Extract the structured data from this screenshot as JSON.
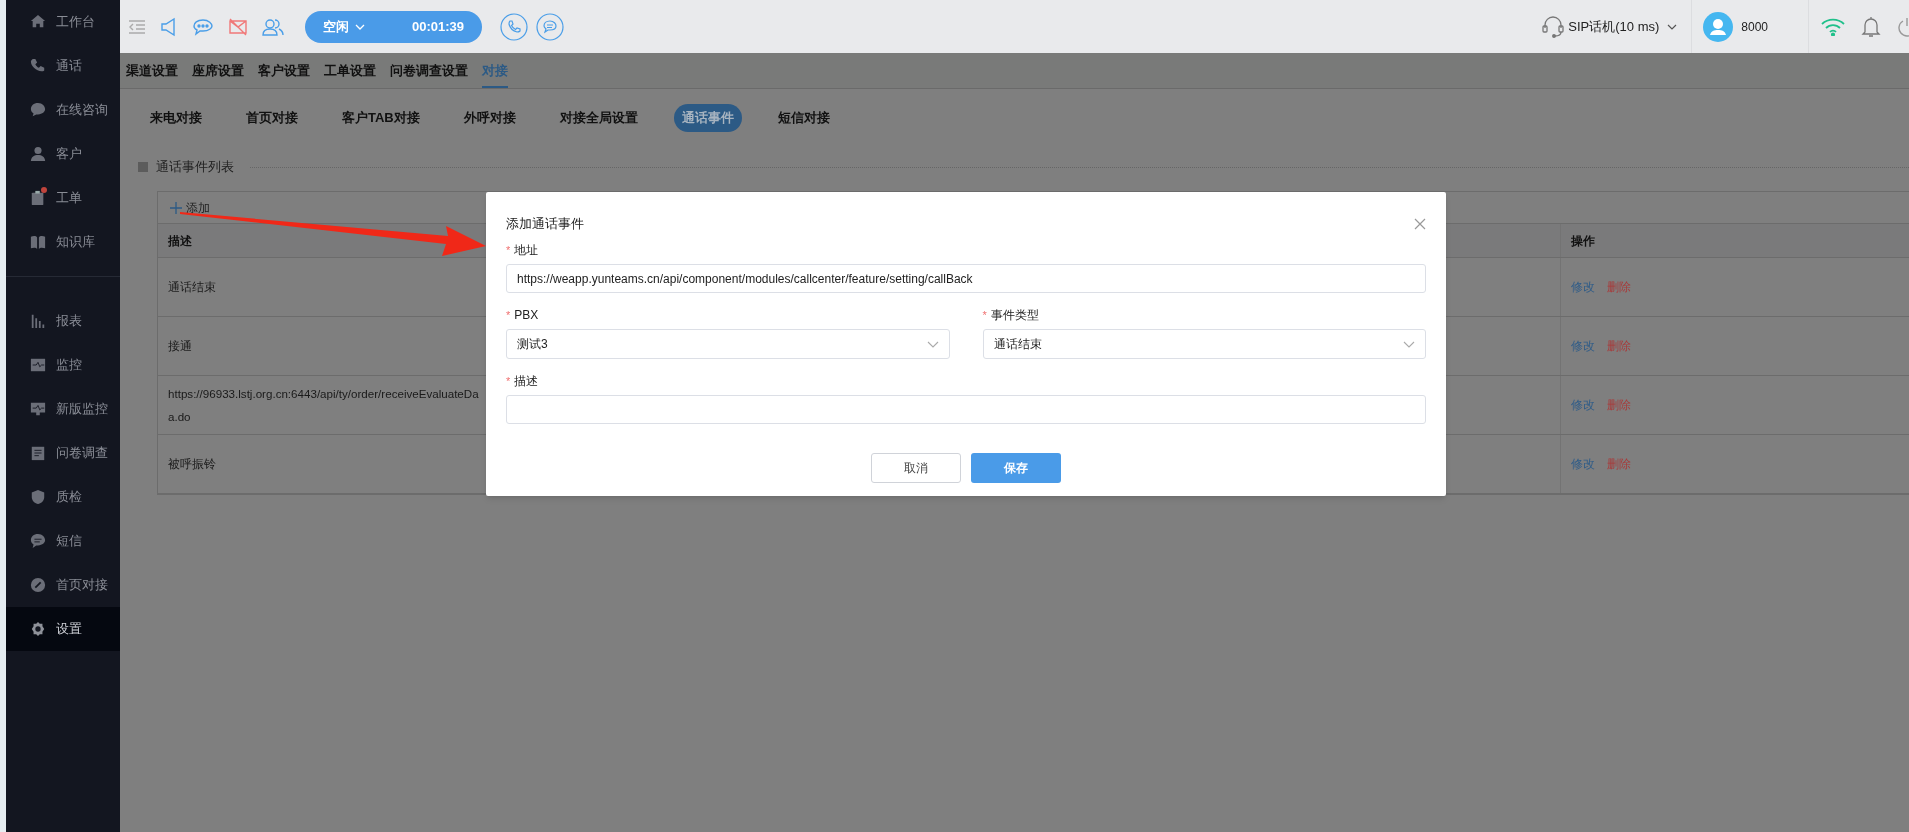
{
  "sidebar": {
    "groups": [
      {
        "items": [
          {
            "label": "工作台",
            "selected": false,
            "notification": false
          },
          {
            "label": "通话",
            "selected": false,
            "notification": false
          },
          {
            "label": "在线咨询",
            "selected": false,
            "notification": false
          },
          {
            "label": "客户",
            "selected": false,
            "notification": false
          },
          {
            "label": "工单",
            "selected": false,
            "notification": true
          },
          {
            "label": "知识库",
            "selected": false,
            "notification": false
          }
        ]
      },
      {
        "items": [
          {
            "label": "报表",
            "selected": false,
            "notification": false
          },
          {
            "label": "监控",
            "selected": false,
            "notification": false
          },
          {
            "label": "新版监控",
            "selected": false,
            "notification": false
          },
          {
            "label": "问卷调查",
            "selected": false,
            "notification": false
          },
          {
            "label": "质检",
            "selected": false,
            "notification": false
          },
          {
            "label": "短信",
            "selected": false,
            "notification": false
          },
          {
            "label": "首页对接",
            "selected": false,
            "notification": false
          },
          {
            "label": "设置",
            "selected": true,
            "notification": false
          }
        ]
      }
    ]
  },
  "top_bar": {
    "status": "空闲",
    "timer": "00:01:39",
    "phone": "SIP话机(10 ms)",
    "agent": "8000"
  },
  "tabs": [
    {
      "label": "渠道设置",
      "selected": false
    },
    {
      "label": "座席设置",
      "selected": false
    },
    {
      "label": "客户设置",
      "selected": false
    },
    {
      "label": "工单设置",
      "selected": false
    },
    {
      "label": "问卷调查设置",
      "selected": false
    },
    {
      "label": "对接",
      "selected": true
    }
  ],
  "sub_tabs": [
    {
      "label": "来电对接",
      "selected": false
    },
    {
      "label": "首页对接",
      "selected": false
    },
    {
      "label": "客户TAB对接",
      "selected": false
    },
    {
      "label": "外呼对接",
      "selected": false
    },
    {
      "label": "对接全局设置",
      "selected": false
    },
    {
      "label": "通话事件",
      "selected": true
    },
    {
      "label": "短信对接",
      "selected": false
    }
  ],
  "section_title": "通话事件列表",
  "add_button": "添加",
  "table": {
    "columns": [
      "描述",
      "操作"
    ],
    "rows": [
      {
        "description": [
          "通话结束"
        ],
        "actions": [
          "修改",
          "删除"
        ]
      },
      {
        "description": [
          "接通"
        ],
        "actions": [
          "修改",
          "删除"
        ]
      },
      {
        "description": [
          "https://96933.lstj.org.cn:6443/api/ty/order/receiveEvaluateDa",
          "a.do"
        ],
        "actions": [
          "修改",
          "删除"
        ]
      },
      {
        "description": [
          "被呼振铃"
        ],
        "actions": [
          "修改",
          "删除"
        ]
      }
    ]
  },
  "dialog": {
    "title": "添加通话事件",
    "fields": [
      {
        "mark": "*",
        "label": "地址",
        "kind": "input",
        "value": "https://weapp.yunteams.cn/api/component/modules/callcenter/feature/setting/callBack"
      },
      {
        "mark": "*",
        "label": "PBX",
        "kind": "select",
        "value": "测试3"
      },
      {
        "mark": "*",
        "label": "事件类型",
        "kind": "select",
        "value": "通话结束"
      },
      {
        "mark": "*",
        "label": "描述",
        "kind": "input"
      }
    ],
    "buttons": [
      {
        "label": "取消",
        "kind": "default"
      },
      {
        "label": "保存",
        "kind": "primary"
      }
    ]
  }
}
